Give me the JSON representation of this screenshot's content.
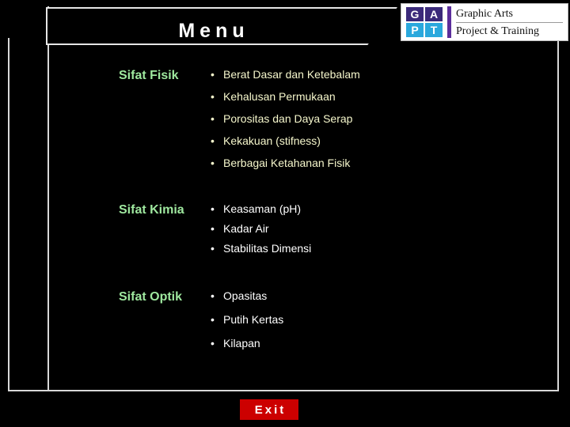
{
  "slide": {
    "title": "Menu",
    "background_color": "#000000"
  },
  "logo": {
    "mark_top": [
      "G",
      "A"
    ],
    "mark_bottom": [
      "P",
      "T"
    ],
    "line1": "Graphic Arts",
    "line2": "Project & Training",
    "colors": {
      "mark_top_bg": "#3b2a7a",
      "mark_bottom_bg": "#2aa8dd",
      "bar": "#5b2d9b",
      "panel_bg": "#ffffff"
    }
  },
  "sections": [
    {
      "heading": "Sifat Fisik",
      "heading_color": "#9fe89f",
      "text_color": "#f6f7cc",
      "bullet_glyph": "•",
      "items": [
        "Berat Dasar dan Ketebalam",
        "Kehalusan Permukaan",
        "Porositas dan Daya Serap",
        "Kekakuan (stifness)",
        "Berbagai Ketahanan Fisik"
      ]
    },
    {
      "heading": "Sifat Kimia",
      "heading_color": "#9fe89f",
      "text_color": "#ffffff",
      "bullet_glyph": "•",
      "items": [
        "Keasaman (pH)",
        "Kadar Air",
        "Stabilitas Dimensi"
      ]
    },
    {
      "heading": "Sifat Optik",
      "heading_color": "#9fe89f",
      "text_color": "#ffffff",
      "bullet_glyph": "•",
      "items": [
        "Opasitas",
        "Putih Kertas",
        "Kilapan"
      ]
    }
  ],
  "exit_button": {
    "label": "Exit",
    "background_color": "#cc0000",
    "text_color": "#ffffff"
  }
}
